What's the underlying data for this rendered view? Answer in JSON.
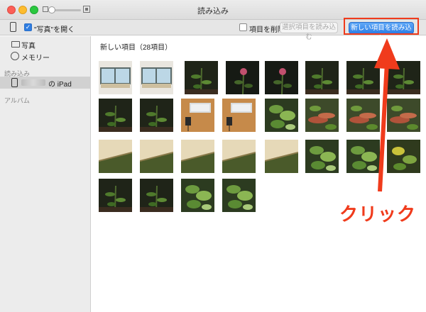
{
  "window": {
    "title": "読み込み"
  },
  "toolbar": {
    "open_photos_label": "\"写真\"を開く",
    "open_photos_checked": true,
    "delete_items_label": "項目を削除",
    "delete_items_checked": false,
    "import_selected_label": "選択項目を読み込む",
    "import_new_label": "新しい項目を読み込む"
  },
  "sidebar": {
    "items": [
      {
        "label": "写真",
        "icon": "photos-icon"
      },
      {
        "label": "メモリー",
        "icon": "memories-icon"
      }
    ],
    "import_header": "読み込み",
    "device_label": "の iPad",
    "album_header": "アルバム"
  },
  "content": {
    "section_title": "新しい項目（28項目）",
    "thumbnails": [
      {
        "subject": "window-sky"
      },
      {
        "subject": "window-sky"
      },
      {
        "subject": "plant-dark"
      },
      {
        "subject": "flower-dark"
      },
      {
        "subject": "flower-dark"
      },
      {
        "subject": "plant-dark"
      },
      {
        "subject": "plant-dark"
      },
      {
        "subject": "plant-dark"
      },
      {
        "subject": "plant-dark"
      },
      {
        "subject": "plant-dark"
      },
      {
        "subject": "laptop-desk"
      },
      {
        "subject": "laptop-desk"
      },
      {
        "subject": "leaves-green"
      },
      {
        "subject": "soil-red"
      },
      {
        "subject": "soil-red"
      },
      {
        "subject": "soil-red"
      },
      {
        "subject": "wood-frame"
      },
      {
        "subject": "wood-frame"
      },
      {
        "subject": "wood-frame"
      },
      {
        "subject": "wood-frame"
      },
      {
        "subject": "wood-frame"
      },
      {
        "subject": "leaves-green"
      },
      {
        "subject": "leaves-green"
      },
      {
        "subject": "leaves-yellow"
      },
      {
        "subject": "plant-dark"
      },
      {
        "subject": "plant-dark"
      },
      {
        "subject": "leaves-green"
      },
      {
        "subject": "leaves-green"
      }
    ]
  },
  "annotation": {
    "label": "クリック",
    "color": "#f03b1c"
  },
  "colors": {
    "accent": "#2d7fe6",
    "annotation": "#f03b1c"
  }
}
